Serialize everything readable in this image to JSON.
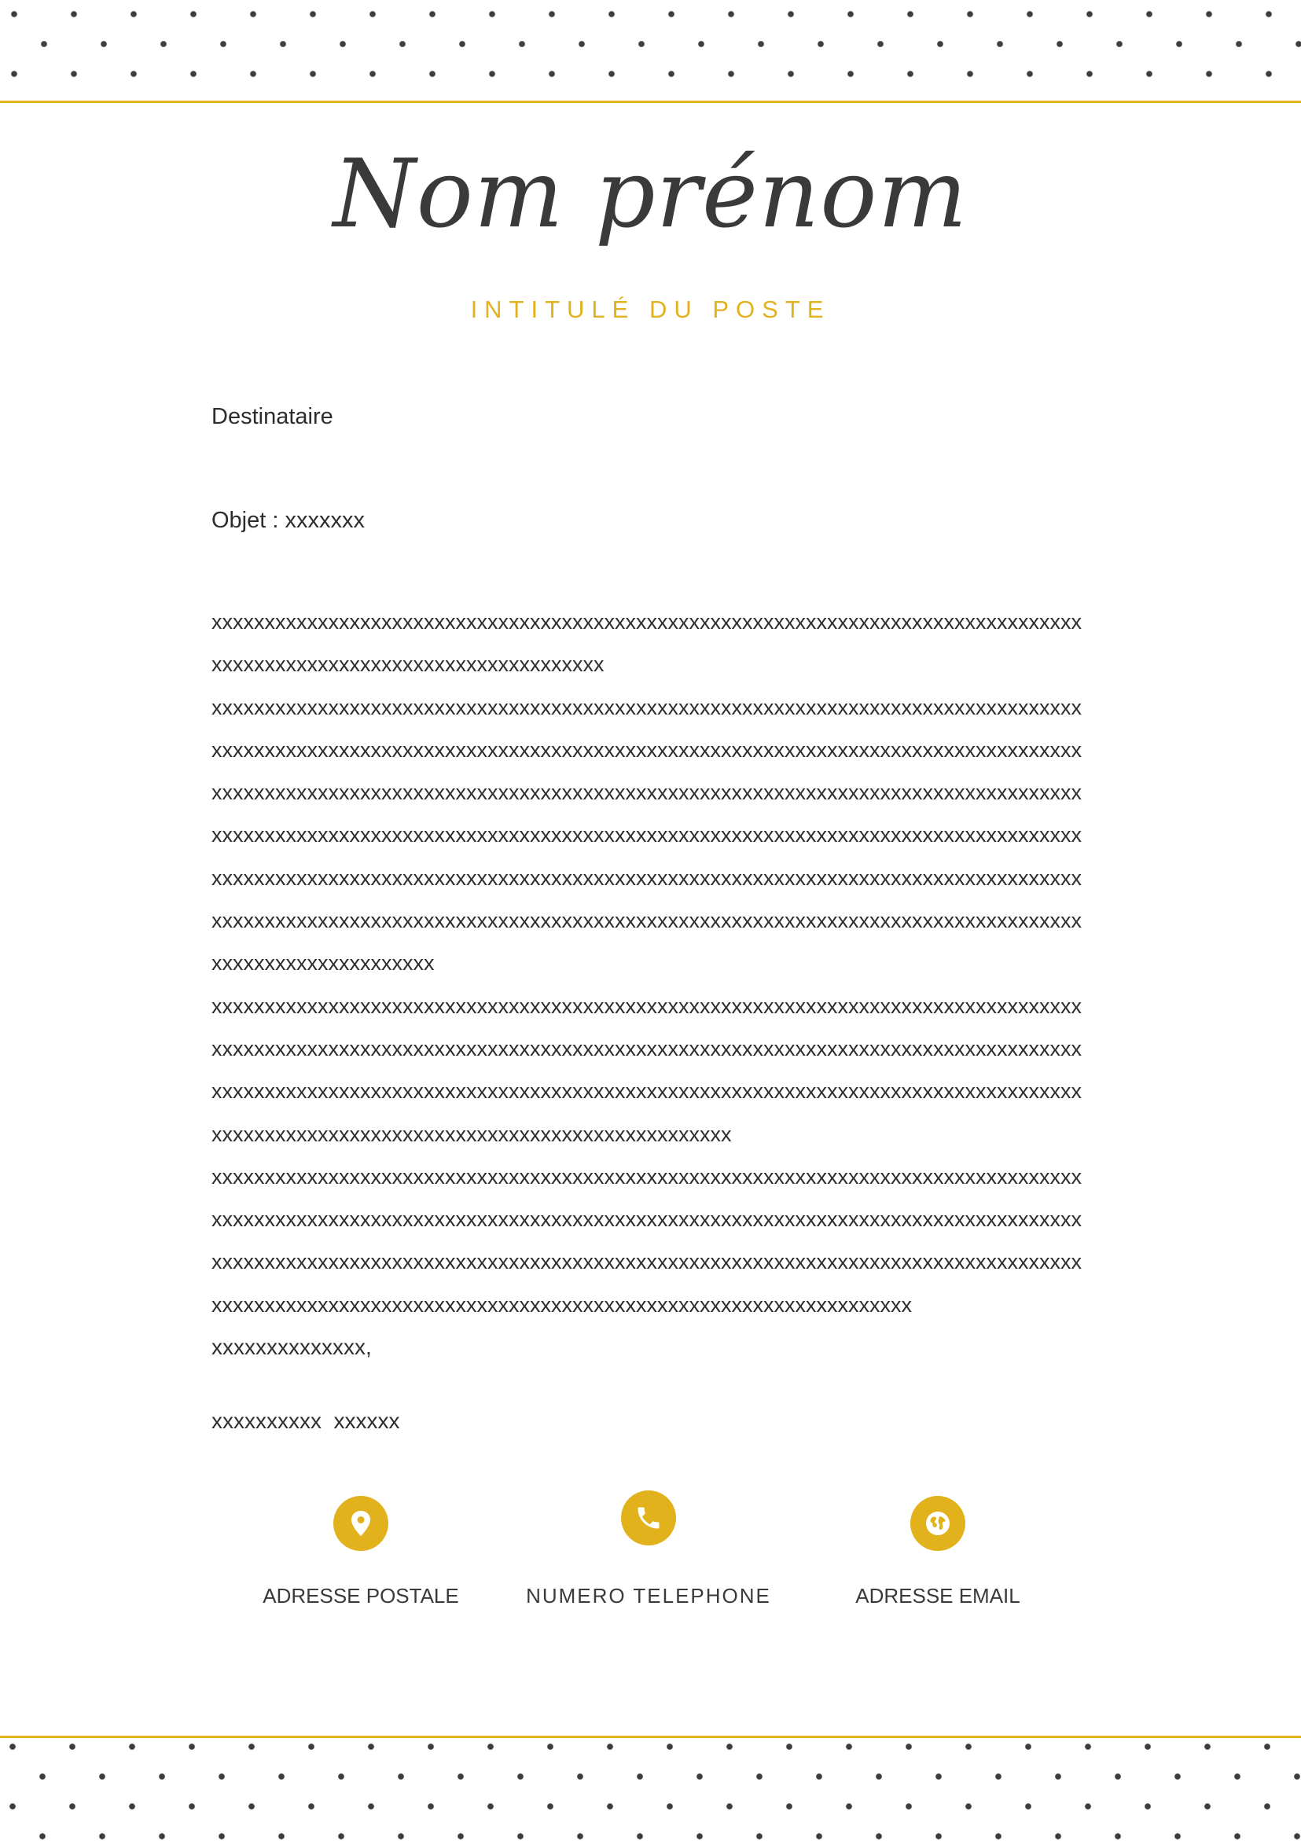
{
  "header": {
    "name": "Nom prénom",
    "job_title": "INTITULÉ DU POSTE"
  },
  "letter": {
    "recipient": "Destinataire",
    "subject": "Objet : xxxxxxx",
    "body_lines": [
      "xxxxxxxxxxxxxxxxxxxxxxxxxxxxxxxxxxxxxxxxxxxxxxxxxxxxxxxxxxxxxxxxxxxxxxxxxxxxxxxxxx",
      "xxxxxxxxxxxxxxxxxxxxxxxxxxxxxxxxxxxxx",
      "xxxxxxxxxxxxxxxxxxxxxxxxxxxxxxxxxxxxxxxxxxxxxxxxxxxxxxxxxxxxxxxxxxxxxxxxxxxxxxxxxx",
      "xxxxxxxxxxxxxxxxxxxxxxxxxxxxxxxxxxxxxxxxxxxxxxxxxxxxxxxxxxxxxxxxxxxxxxxxxxxxxxxxxx",
      "xxxxxxxxxxxxxxxxxxxxxxxxxxxxxxxxxxxxxxxxxxxxxxxxxxxxxxxxxxxxxxxxxxxxxxxxxxxxxxxxxx",
      "xxxxxxxxxxxxxxxxxxxxxxxxxxxxxxxxxxxxxxxxxxxxxxxxxxxxxxxxxxxxxxxxxxxxxxxxxxxxxxxxxx",
      "xxxxxxxxxxxxxxxxxxxxxxxxxxxxxxxxxxxxxxxxxxxxxxxxxxxxxxxxxxxxxxxxxxxxxxxxxxxxxxxxxx",
      "xxxxxxxxxxxxxxxxxxxxxxxxxxxxxxxxxxxxxxxxxxxxxxxxxxxxxxxxxxxxxxxxxxxxxxxxxxxxxxxxxx",
      "xxxxxxxxxxxxxxxxxxxxx",
      "xxxxxxxxxxxxxxxxxxxxxxxxxxxxxxxxxxxxxxxxxxxxxxxxxxxxxxxxxxxxxxxxxxxxxxxxxxxxxxxxxx",
      "xxxxxxxxxxxxxxxxxxxxxxxxxxxxxxxxxxxxxxxxxxxxxxxxxxxxxxxxxxxxxxxxxxxxxxxxxxxxxxxxxx",
      "xxxxxxxxxxxxxxxxxxxxxxxxxxxxxxxxxxxxxxxxxxxxxxxxxxxxxxxxxxxxxxxxxxxxxxxxxxxxxxxxxx",
      "xxxxxxxxxxxxxxxxxxxxxxxxxxxxxxxxxxxxxxxxxxxxxxxxx",
      "xxxxxxxxxxxxxxxxxxxxxxxxxxxxxxxxxxxxxxxxxxxxxxxxxxxxxxxxxxxxxxxxxxxxxxxxxxxxxxxxxx",
      "xxxxxxxxxxxxxxxxxxxxxxxxxxxxxxxxxxxxxxxxxxxxxxxxxxxxxxxxxxxxxxxxxxxxxxxxxxxxxxxxxx",
      "xxxxxxxxxxxxxxxxxxxxxxxxxxxxxxxxxxxxxxxxxxxxxxxxxxxxxxxxxxxxxxxxxxxxxxxxxxxxxxxxxx",
      "xxxxxxxxxxxxxxxxxxxxxxxxxxxxxxxxxxxxxxxxxxxxxxxxxxxxxxxxxxxxxxxxxx"
    ],
    "closing": "xxxxxxxxxxxxxx,",
    "signature": "xxxxxxxxxx  xxxxxx"
  },
  "contacts": {
    "address": {
      "label": "ADRESSE POSTALE",
      "icon": "map-pin-icon"
    },
    "phone": {
      "label": "NUMERO TELEPHONE",
      "icon": "phone-icon"
    },
    "email": {
      "label": "ADRESSE EMAIL",
      "icon": "globe-icon"
    }
  },
  "colors": {
    "accent": "#e2b21d",
    "text": "#2d2d2d",
    "dots": "#3d3d3d"
  }
}
